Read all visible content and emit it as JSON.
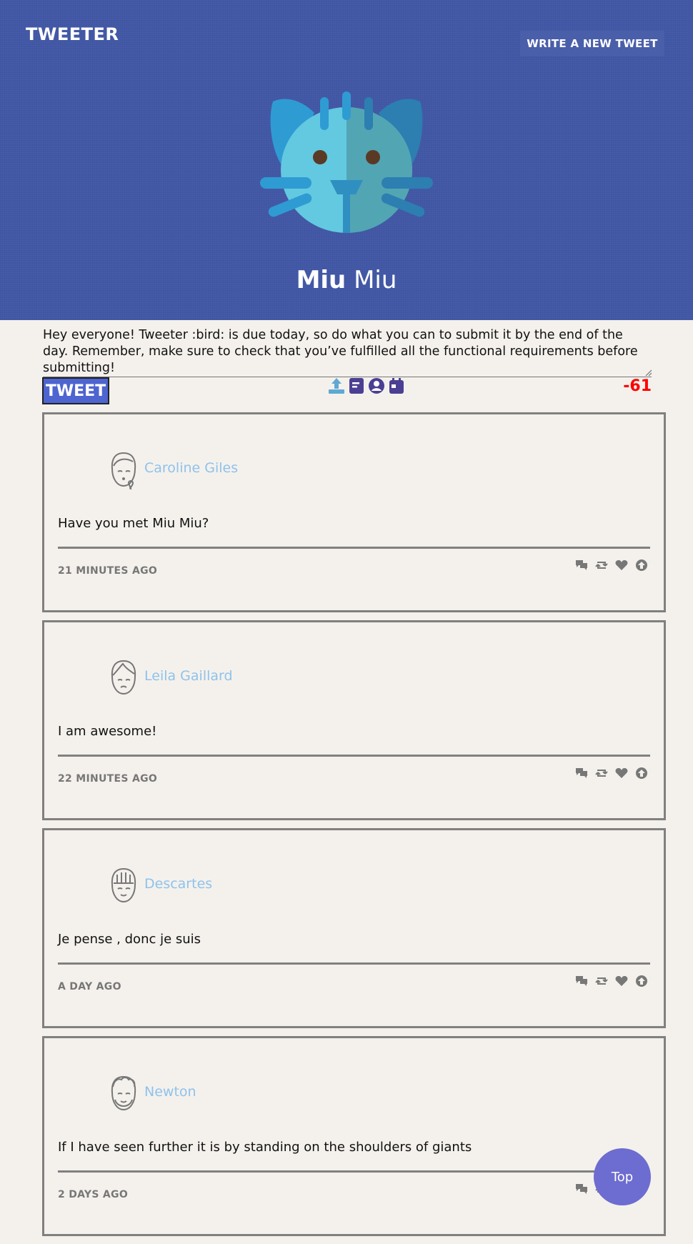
{
  "nav": {
    "brand": "TWEETER",
    "write_button": "WRITE A NEW TWEET"
  },
  "profile": {
    "first_name": "Miu",
    "last_name": "Miu"
  },
  "compose": {
    "text": "Hey everyone! Tweeter :bird: is due today, so do what you can to submit it by the end of the day. Remember, make sure to check that you’ve fulfilled all the functional requirements before submitting!",
    "tweet_button": "TWEET",
    "counter": "-61",
    "icons": [
      "upload-icon",
      "document-icon",
      "user-circle-icon",
      "calendar-icon"
    ]
  },
  "tweets": [
    {
      "author": "Caroline Giles",
      "text": "Have you met Miu Miu?",
      "time": "21 MINUTES AGO",
      "avatar": "woman-avatar-icon"
    },
    {
      "author": "Leila Gaillard",
      "text": "I am awesome!",
      "time": "22 MINUTES AGO",
      "avatar": "girl-avatar-icon"
    },
    {
      "author": "Descartes",
      "text": "Je pense , donc je suis",
      "time": "A DAY AGO",
      "avatar": "bangs-avatar-icon"
    },
    {
      "author": "Newton",
      "text": "If I have seen further it is by standing on the shoulders of giants",
      "time": "2 DAYS AGO",
      "avatar": "bearded-avatar-icon"
    }
  ],
  "tweet_actions": [
    "comments-icon",
    "retweet-icon",
    "heart-icon",
    "upvote-icon"
  ],
  "top_button": "Top",
  "colors": {
    "header": "#4258a6",
    "background": "#f4f1ec",
    "tweet_button": "#4e64d0",
    "counter": "#ff0000",
    "author": "#8fc2ec",
    "top_button": "#6d6cd0"
  }
}
